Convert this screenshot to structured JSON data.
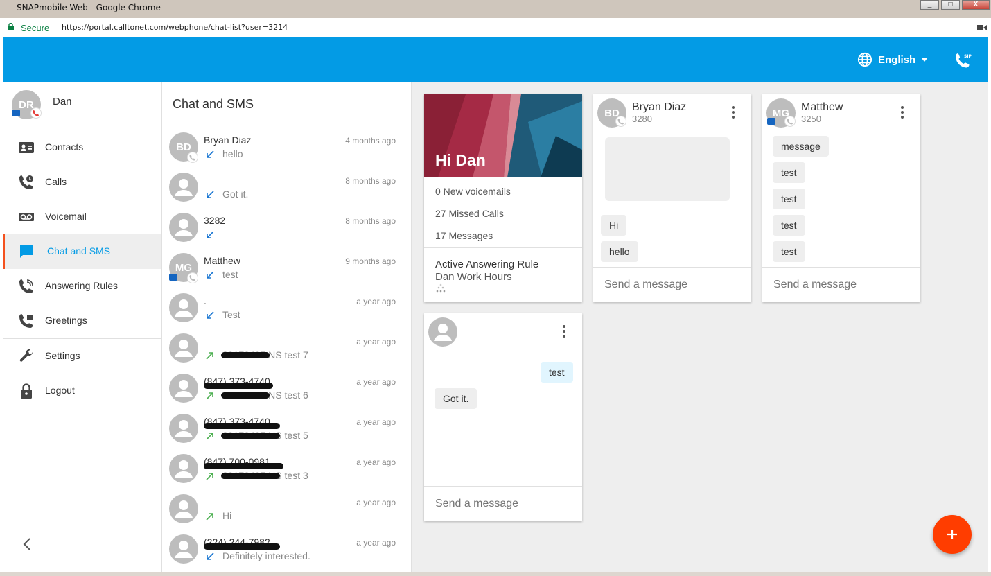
{
  "window": {
    "title": "SNAPmobile Web - Google Chrome",
    "min": "_",
    "max": "□",
    "close": "X"
  },
  "address": {
    "secure": "Secure",
    "url": "https://portal.calltonet.com/webphone/chat-list?user=3214"
  },
  "header": {
    "language": "English"
  },
  "profile": {
    "initials": "DR",
    "name": "Dan"
  },
  "nav": [
    {
      "label": "Contacts",
      "icon": "contacts-icon"
    },
    {
      "label": "Calls",
      "icon": "calls-icon"
    },
    {
      "label": "Voicemail",
      "icon": "voicemail-icon"
    },
    {
      "label": "Chat and SMS",
      "icon": "chat-icon"
    },
    {
      "label": "Answering Rules",
      "icon": "answering-rules-icon"
    },
    {
      "label": "Greetings",
      "icon": "greetings-icon"
    },
    {
      "label": "Settings",
      "icon": "wrench-icon"
    },
    {
      "label": "Logout",
      "icon": "lock-icon"
    }
  ],
  "chatlist": {
    "title": "Chat and SMS",
    "items": [
      {
        "initials": "BD",
        "name": "Bryan Diaz",
        "time": "4 months ago",
        "message": "hello",
        "direction": "in"
      },
      {
        "initials": "",
        "name": "",
        "time": "8 months ago",
        "message": "Got it.",
        "direction": "in"
      },
      {
        "initials": "",
        "name": "3282",
        "time": "8 months ago",
        "message": "",
        "direction": "in"
      },
      {
        "initials": "MG",
        "name": "Matthew",
        "time": "9 months ago",
        "message": "test",
        "direction": "in"
      },
      {
        "initials": "",
        "name": ".",
        "time": "a year ago",
        "message": "Test",
        "direction": "in"
      },
      {
        "initials": "",
        "name": "",
        "time": "a year ago",
        "message": "20170407 NS test 7",
        "direction": "out"
      },
      {
        "initials": "",
        "name": "(847) 373-4740",
        "time": "a year ago",
        "message": "20170407 NS test 6",
        "direction": "out"
      },
      {
        "initials": "",
        "name": "(847) 373-4740",
        "time": "a year ago",
        "message": "20170407 NS test 5",
        "direction": "out"
      },
      {
        "initials": "",
        "name": "(847) 700-0981",
        "time": "a year ago",
        "message": "20170407 NS test 3",
        "direction": "out"
      },
      {
        "initials": "",
        "name": "",
        "time": "a year ago",
        "message": "Hi",
        "direction": "out"
      },
      {
        "initials": "",
        "name": "(224) 244-7982",
        "time": "a year ago",
        "message": "Definitely interested.",
        "direction": "in"
      }
    ]
  },
  "welcome": {
    "greeting": "Hi Dan",
    "voicemails": "0 New voicemails",
    "missed": "27 Missed Calls",
    "messages": "17 Messages",
    "rule_title": "Active Answering Rule",
    "rule_name": "Dan Work Hours"
  },
  "chats": [
    {
      "initials": "BD",
      "name": "Bryan Diaz",
      "ext": "3280",
      "messages": [
        "Hi",
        "hello"
      ],
      "placeholder": "Send a message"
    },
    {
      "initials": "MG",
      "name": "Matthew",
      "ext": "3250",
      "messages": [
        "message",
        "test",
        "test",
        "test",
        "test"
      ],
      "placeholder": "Send a message"
    },
    {
      "initials": "",
      "name": "",
      "ext": "",
      "outgoing": "test",
      "incoming": "Got it.",
      "placeholder": "Send a message"
    }
  ],
  "colors": {
    "header": "#039be5",
    "accent": "#f4511e",
    "fab": "#ff3d00",
    "incoming": "#1976d2",
    "outgoing": "#4caf50"
  }
}
